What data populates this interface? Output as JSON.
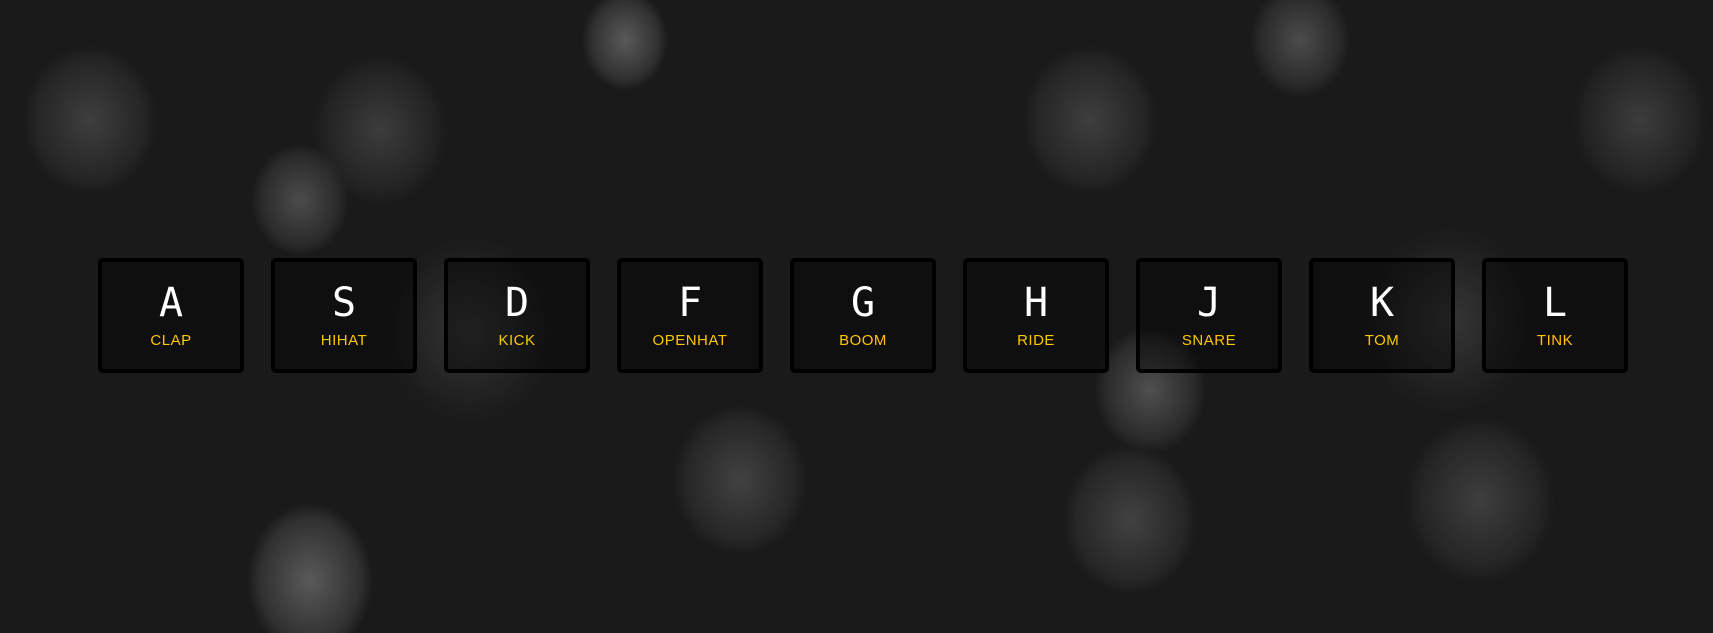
{
  "colors": {
    "key_letter": "#ffffff",
    "sound_label": "#ffc600",
    "key_border": "#000000"
  },
  "keys": [
    {
      "letter": "A",
      "sound": "CLAP"
    },
    {
      "letter": "S",
      "sound": "HIHAT"
    },
    {
      "letter": "D",
      "sound": "KICK"
    },
    {
      "letter": "F",
      "sound": "OPENHAT"
    },
    {
      "letter": "G",
      "sound": "BOOM"
    },
    {
      "letter": "H",
      "sound": "RIDE"
    },
    {
      "letter": "J",
      "sound": "SNARE"
    },
    {
      "letter": "K",
      "sound": "TOM"
    },
    {
      "letter": "L",
      "sound": "TINK"
    }
  ]
}
